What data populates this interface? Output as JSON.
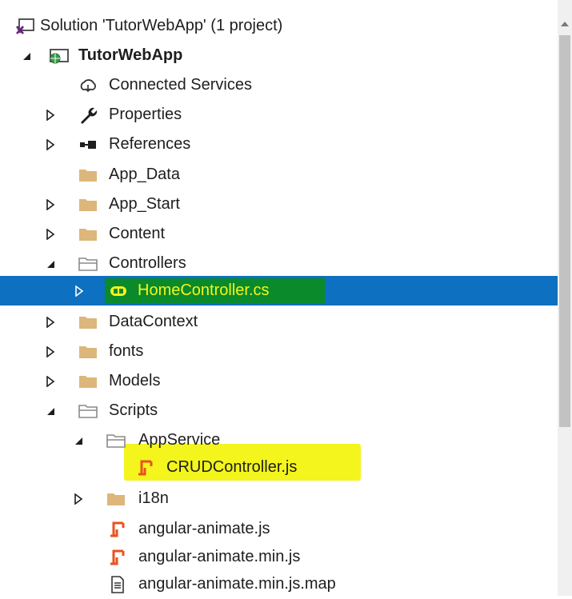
{
  "solution_explorer": {
    "items": [
      {
        "label": "Solution 'TutorWebApp' (1 project)",
        "icon": "solution-icon",
        "expander": "none"
      },
      {
        "label": "TutorWebApp",
        "icon": "web-project-icon",
        "expander": "expanded"
      },
      {
        "label": "Connected Services",
        "icon": "connected-services-icon",
        "expander": "none"
      },
      {
        "label": "Properties",
        "icon": "wrench-icon",
        "expander": "collapsed"
      },
      {
        "label": "References",
        "icon": "references-icon",
        "expander": "collapsed"
      },
      {
        "label": "App_Data",
        "icon": "folder-icon",
        "expander": "none"
      },
      {
        "label": "App_Start",
        "icon": "folder-icon",
        "expander": "collapsed"
      },
      {
        "label": "Content",
        "icon": "folder-icon",
        "expander": "collapsed"
      },
      {
        "label": "Controllers",
        "icon": "folder-open-icon",
        "expander": "expanded"
      },
      {
        "label": "HomeController.cs",
        "icon": "csharp-class-icon",
        "expander": "collapsed",
        "selected": true
      },
      {
        "label": "DataContext",
        "icon": "folder-icon",
        "expander": "collapsed"
      },
      {
        "label": "fonts",
        "icon": "folder-icon",
        "expander": "collapsed"
      },
      {
        "label": "Models",
        "icon": "folder-icon",
        "expander": "collapsed"
      },
      {
        "label": "Scripts",
        "icon": "folder-open-icon",
        "expander": "expanded"
      },
      {
        "label": "AppService",
        "icon": "folder-open-icon",
        "expander": "expanded"
      },
      {
        "label": "CRUDController.js",
        "icon": "js-file-icon",
        "expander": "none",
        "highlighted": true
      },
      {
        "label": "i18n",
        "icon": "folder-icon",
        "expander": "collapsed"
      },
      {
        "label": "angular-animate.js",
        "icon": "js-file-icon",
        "expander": "none"
      },
      {
        "label": "angular-animate.min.js",
        "icon": "js-file-icon",
        "expander": "none"
      },
      {
        "label": "angular-animate.min.js.map",
        "icon": "map-file-icon",
        "expander": "none"
      }
    ]
  },
  "colors": {
    "selection": "#0e70c0",
    "selection_text_highlight": "#0a8a2a",
    "selection_text": "#f3f51c",
    "marker_highlight": "#f3f51c",
    "folder": "#dcb67a",
    "js_icon": "#e8521f"
  }
}
